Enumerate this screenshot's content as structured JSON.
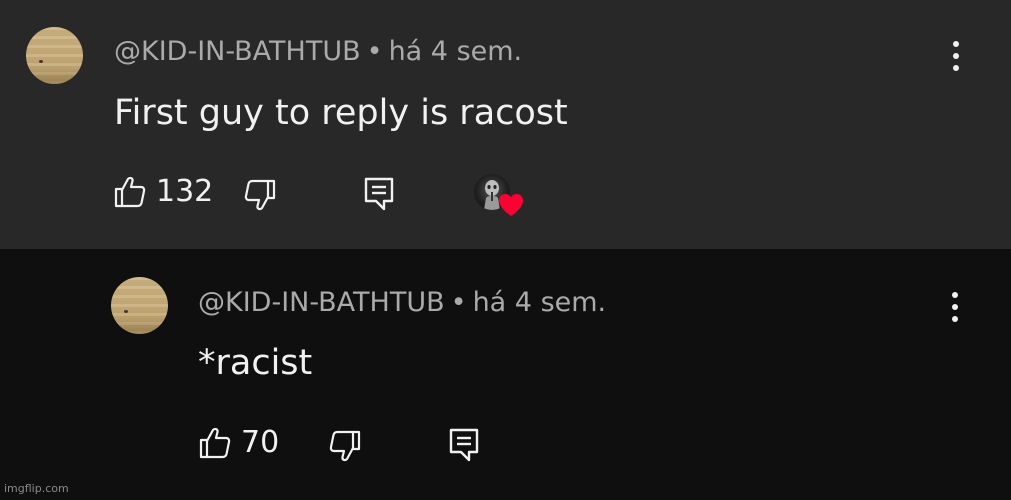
{
  "comments": [
    {
      "handle": "@KID-IN-BATHTUB",
      "separator": "•",
      "time": "há 4 sem.",
      "text": "First guy to reply is racost",
      "likes": "132"
    },
    {
      "handle": "@KID-IN-BATHTUB",
      "separator": "•",
      "time": "há 4 sem.",
      "text": "*racist",
      "likes": "70"
    }
  ],
  "watermark": "imgflip.com",
  "colors": {
    "top_background": "#282828",
    "reply_background": "#0f0f0f",
    "meta_text": "#aaaaaa",
    "main_text": "#f1f1f1",
    "heart": "#ff0033"
  },
  "icons": [
    "like-icon",
    "dislike-icon",
    "reply-icon",
    "more-options-icon",
    "creator-heart-icon"
  ]
}
